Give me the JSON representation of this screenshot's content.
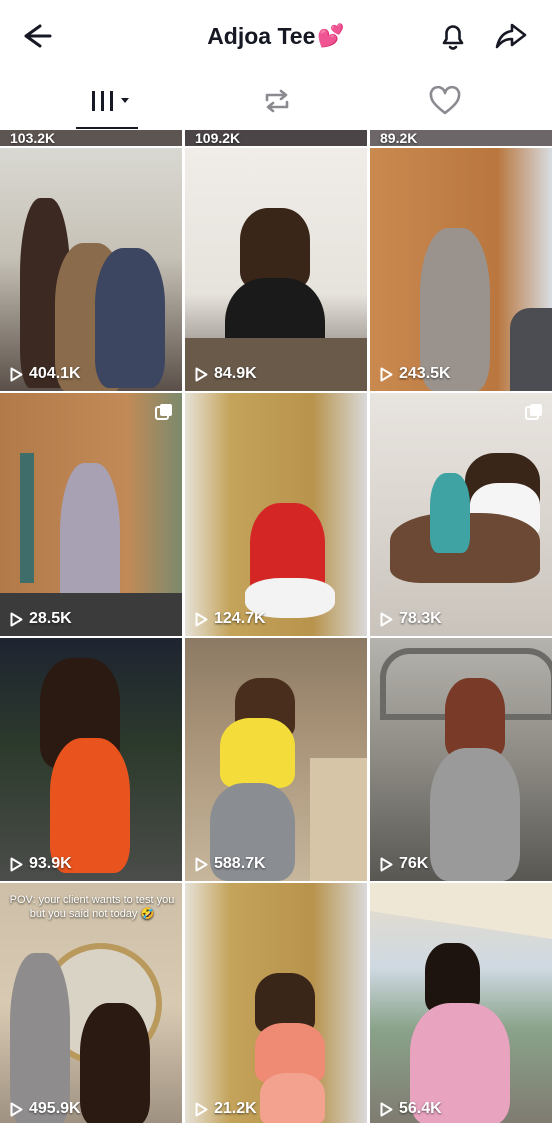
{
  "header": {
    "title": "Adjoa Tee",
    "title_emoji": "💕"
  },
  "tabs": {
    "videos_icon": "grid-bars-icon",
    "repost_icon": "repost-icon",
    "liked_icon": "heart-icon"
  },
  "partial_row": [
    "103.2K",
    "109.2K",
    "89.2K"
  ],
  "videos": [
    {
      "views": "404.1K"
    },
    {
      "views": "84.9K"
    },
    {
      "views": "243.5K"
    },
    {
      "views": "28.5K",
      "multi": true
    },
    {
      "views": "124.7K"
    },
    {
      "views": "78.3K",
      "multi": true
    },
    {
      "views": "93.9K"
    },
    {
      "views": "588.7K"
    },
    {
      "views": "76K"
    },
    {
      "views": "495.9K",
      "caption": "POV: your client wants to test you but you said not today 🤣"
    },
    {
      "views": "21.2K"
    },
    {
      "views": "56.4K"
    }
  ],
  "colors": {
    "text_primary": "#161823",
    "tab_inactive": "#8a8b91"
  }
}
